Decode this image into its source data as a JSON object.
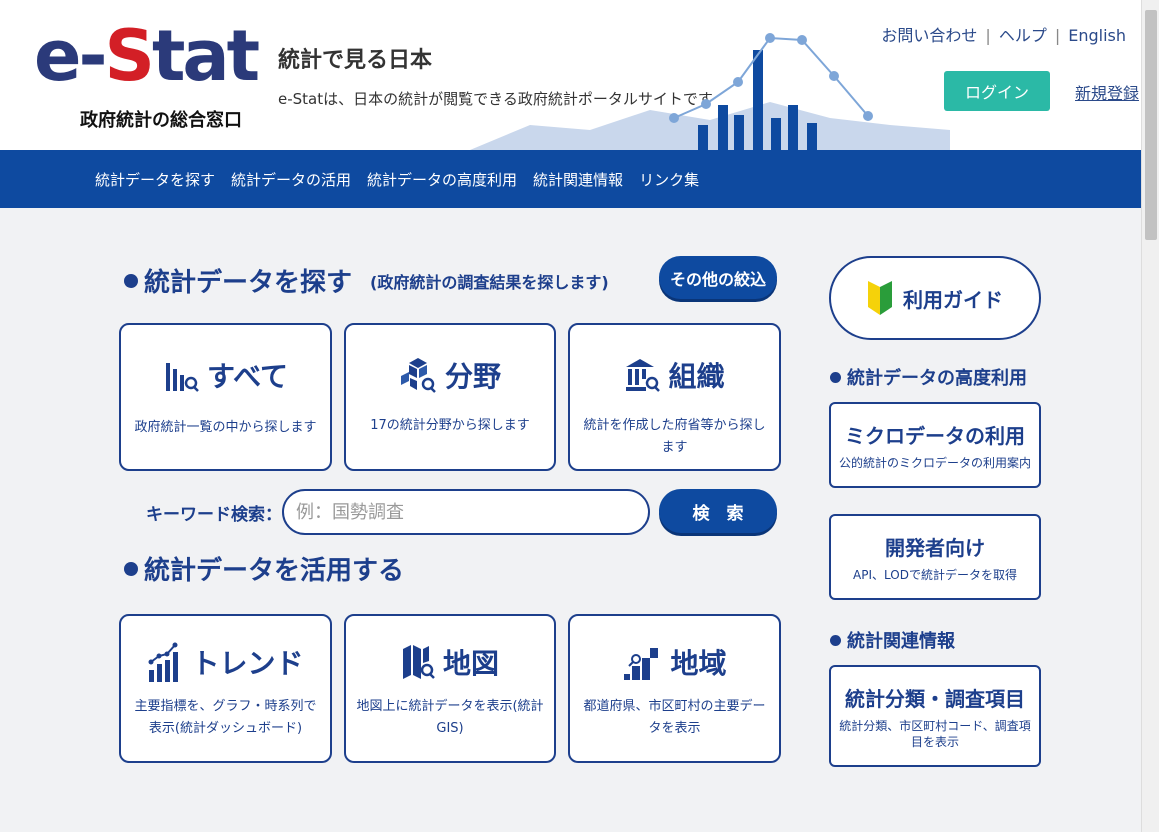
{
  "header": {
    "logo_prefix": "e-",
    "logo_s": "S",
    "logo_suffix": "tat",
    "logo_sub": "政府統計の総合窓口",
    "tagline": "統計で見る日本",
    "subtagline": "e-Statは、日本の統計が閲覧できる政府統計ポータルサイトです",
    "links": [
      "お問い合わせ",
      "ヘルプ",
      "English"
    ],
    "login_label": "ログイン",
    "register_label": "新規登録"
  },
  "nav": {
    "items": [
      "統計データを探す",
      "統計データの活用",
      "統計データの高度利用",
      "統計関連情報",
      "リンク集"
    ]
  },
  "search_section": {
    "title": "統計データを探す",
    "note": "(政府統計の調査結果を探します)",
    "filter_button": "その他の絞込",
    "cards": [
      {
        "icon": "bar-chart-search-icon",
        "title": "すべて",
        "desc": "政府統計一覧の中から探します"
      },
      {
        "icon": "cubes-search-icon",
        "title": "分野",
        "desc": "17の統計分野から探します"
      },
      {
        "icon": "building-search-icon",
        "title": "組織",
        "desc": "統計を作成した府省等から探します"
      }
    ],
    "keyword_label": "キーワード検索：",
    "keyword_placeholder": "例：国勢調査",
    "search_button": "検　索"
  },
  "use_section": {
    "title": "統計データを活用する",
    "cards": [
      {
        "icon": "trend-chart-icon",
        "title": "トレンド",
        "desc": "主要指標を、グラフ・時系列で表示(統計ダッシュボード)"
      },
      {
        "icon": "map-search-icon",
        "title": "地図",
        "desc": "地図上に統計データを表示(統計GIS)"
      },
      {
        "icon": "region-chart-icon",
        "title": "地域",
        "desc": "都道府県、市区町村の主要データを表示"
      }
    ]
  },
  "right": {
    "guide_label": "利用ガイド",
    "advanced_title": "統計データの高度利用",
    "micro_title": "ミクロデータの利用",
    "micro_desc": "公的統計のミクロデータの利用案内",
    "dev_title": "開発者向け",
    "dev_desc": "API、LODで統計データを取得",
    "related_title": "統計関連情報",
    "class_title": "統計分類・調査項目",
    "class_desc": "統計分類、市区町村コード、調査項目を表示"
  },
  "colors": {
    "brand_blue": "#0e4aa0",
    "accent_red": "#d31f26",
    "login_teal": "#2bb9a6"
  }
}
